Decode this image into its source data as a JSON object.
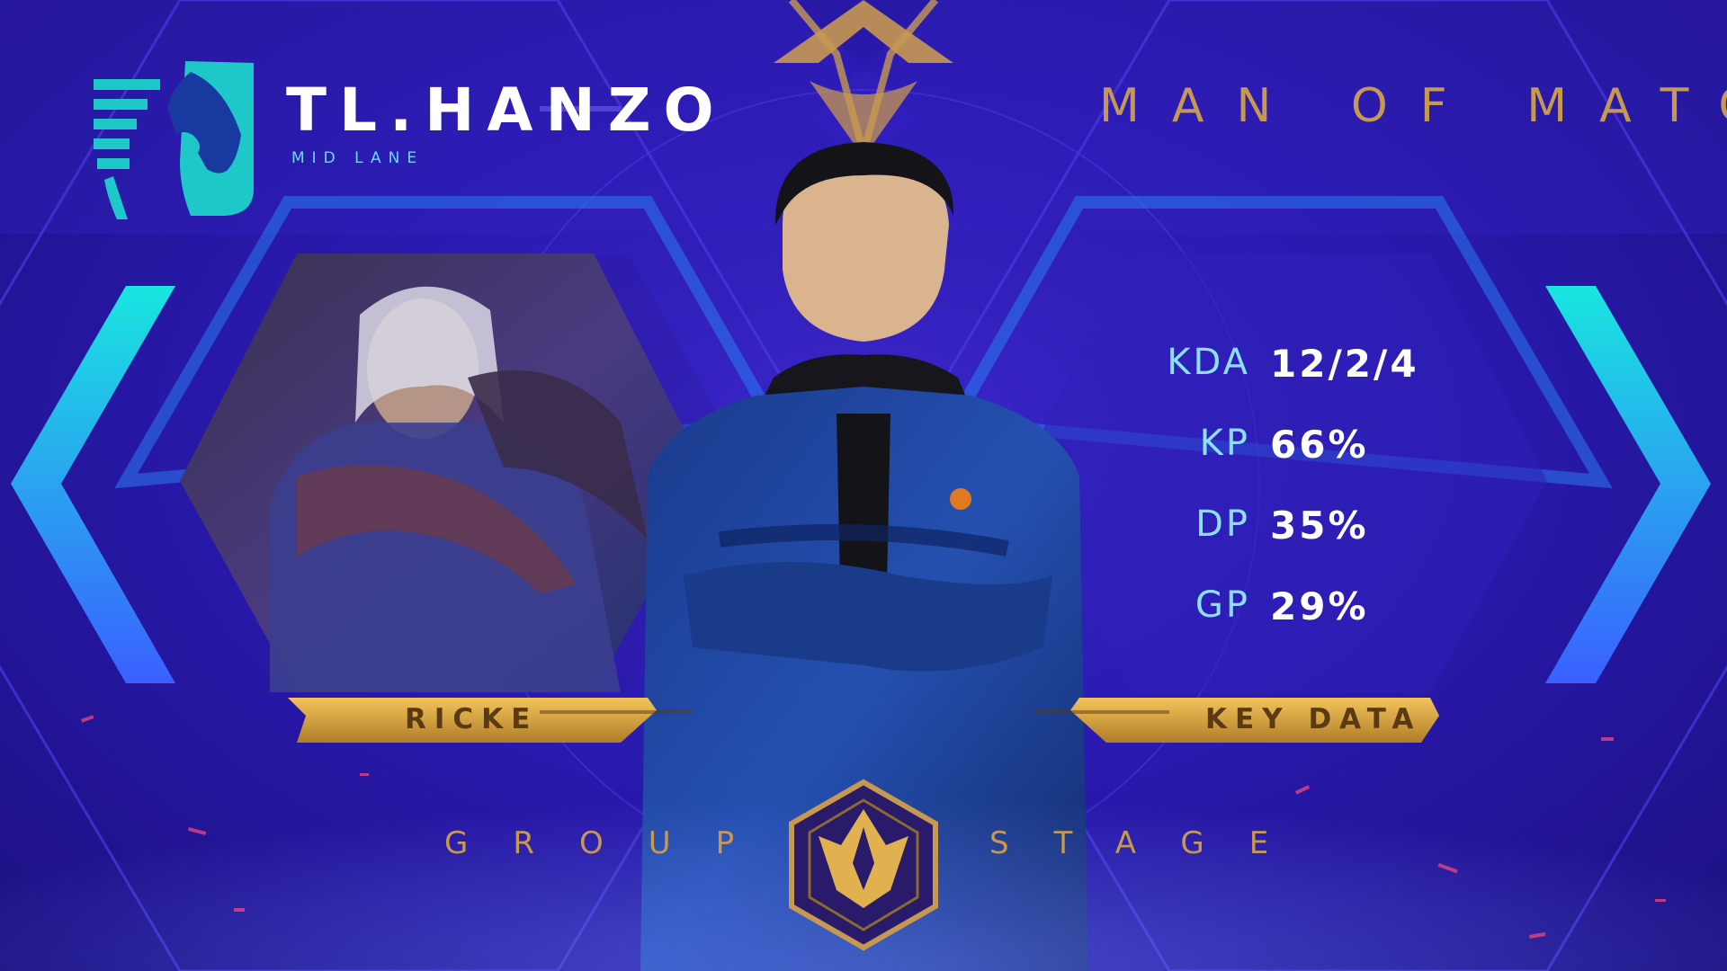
{
  "team": {
    "name": "TL.HANZO",
    "role": "MID LANE"
  },
  "header": {
    "title": "MAN OF MATCH"
  },
  "hero_panel": {
    "label": "RICKE"
  },
  "key_panel": {
    "label": "KEY DATA"
  },
  "stats": [
    {
      "key": "KDA",
      "value": "12/2/4"
    },
    {
      "key": "KP",
      "value": "66%"
    },
    {
      "key": "DP",
      "value": "35%"
    },
    {
      "key": "GP",
      "value": "29%"
    }
  ],
  "footer": {
    "word1": "GROUP",
    "word2": "STAGE"
  },
  "colors": {
    "gold": "#c79850",
    "cyan": "#2ee6e0",
    "bg": "#2a1ab0"
  },
  "icons": {
    "logo": "horse-logo-icon",
    "badge": "tournament-badge-icon",
    "arrows": "chevron-icon"
  }
}
